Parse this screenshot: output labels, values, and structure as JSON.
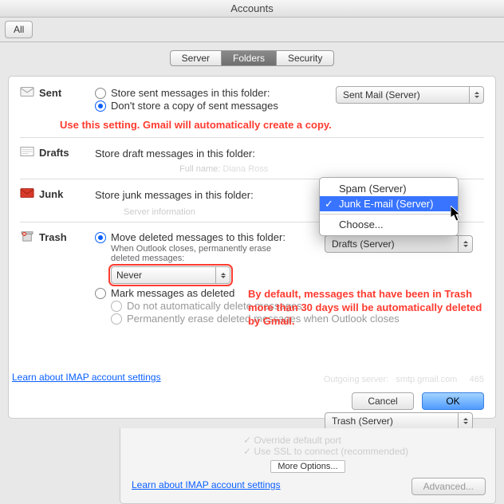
{
  "window": {
    "title": "Accounts",
    "show_all": "All"
  },
  "tabs": {
    "server": "Server",
    "folders": "Folders",
    "security": "Security"
  },
  "sent": {
    "label": "Sent",
    "opt1": "Store sent messages in this folder:",
    "opt2": "Don't store a copy of sent messages",
    "dropdown": "Sent Mail (Server)"
  },
  "annotation1": "Use this setting. Gmail will automatically create a copy.",
  "drafts": {
    "label": "Drafts",
    "text": "Store draft messages in this folder:",
    "dropdown": "Drafts (Server)"
  },
  "junk": {
    "label": "Junk",
    "text": "Store junk messages in this folder:",
    "menu": {
      "spam": "Spam (Server)",
      "selected": "Junk E-mail (Server)",
      "choose": "Choose..."
    }
  },
  "trash": {
    "label": "Trash",
    "opt1": "Move deleted messages to this folder:",
    "note": "When Outlook closes, permanently erase deleted messages:",
    "never": "Never",
    "opt2": "Mark messages as deleted",
    "sub1": "Do not automatically delete messages",
    "sub2": "Permanently erase deleted messages when Outlook closes",
    "dropdown": "Trash (Server)"
  },
  "annotation2": "By default, messages that have been in Trash more than 30 days will be automatically deleted by Gmail.",
  "link": "Learn about IMAP account settings",
  "buttons": {
    "cancel": "Cancel",
    "ok": "OK",
    "more": "More Options...",
    "advanced": "Advanced..."
  },
  "bg": {
    "full_name": "Full name:",
    "name_val": "Diana Ross",
    "server_info": "Server information",
    "out_server": "Outgoing server:",
    "out_val": "smtp.gmail.com",
    "port": "465",
    "ovr": "Override default port",
    "ssl": "Use SSL to connect (recommended)"
  }
}
